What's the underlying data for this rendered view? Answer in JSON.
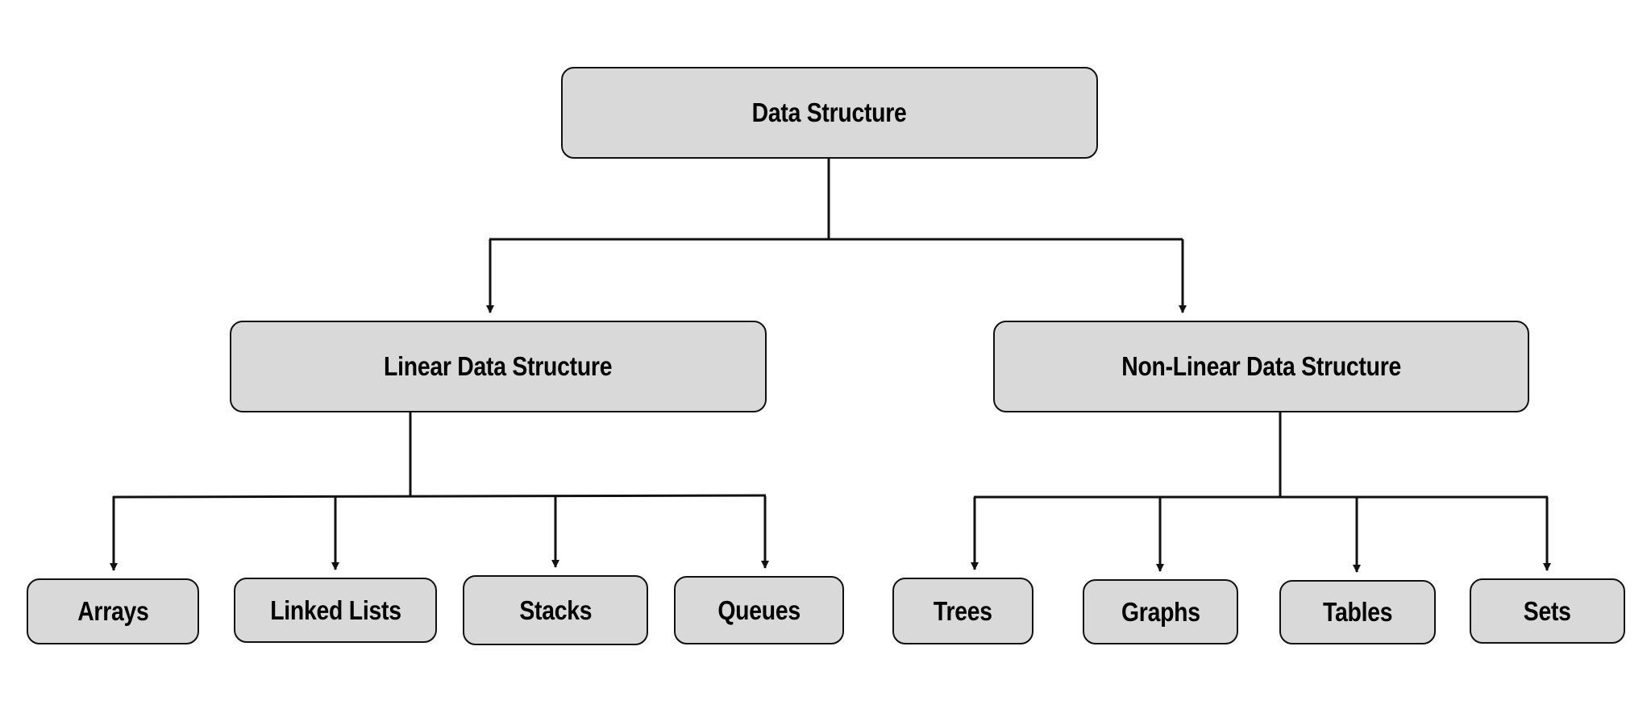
{
  "diagram": {
    "title": "Data Structure",
    "root": {
      "id": "root",
      "label": "Data Structure"
    },
    "categories": [
      {
        "id": "linear",
        "label": "Linear Data Structure",
        "children": [
          {
            "id": "arrays",
            "label": "Arrays"
          },
          {
            "id": "linked-lists",
            "label": "Linked Lists"
          },
          {
            "id": "stacks",
            "label": "Stacks"
          },
          {
            "id": "queues",
            "label": "Queues"
          }
        ]
      },
      {
        "id": "nonlinear",
        "label": "Non-Linear Data Structure",
        "children": [
          {
            "id": "trees",
            "label": "Trees"
          },
          {
            "id": "graphs",
            "label": "Graphs"
          },
          {
            "id": "tables",
            "label": "Tables"
          },
          {
            "id": "sets",
            "label": "Sets"
          }
        ]
      }
    ],
    "colors": {
      "node_fill": "#d9d9d9",
      "stroke": "#111111",
      "text": "#000000",
      "background": "#ffffff"
    }
  }
}
